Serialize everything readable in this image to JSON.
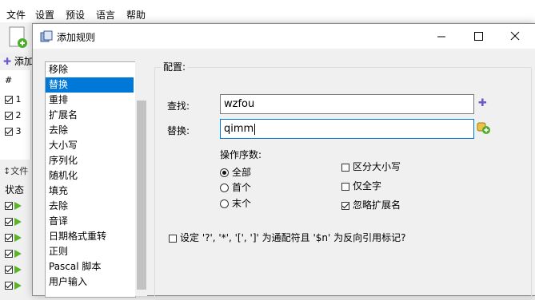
{
  "menubar": [
    "文件",
    "设置",
    "预设",
    "语言",
    "帮助"
  ],
  "background": {
    "add_label": "添加",
    "list_header": "#",
    "rows": [
      "1",
      "2",
      "3"
    ],
    "files_label": "文件",
    "status_label": "状态"
  },
  "dialog": {
    "title": "添加规则",
    "rules": [
      "移除",
      "替换",
      "重排",
      "扩展名",
      "去除",
      "大小写",
      "序列化",
      "随机化",
      "填充",
      "去除",
      "音译",
      "日期格式重转",
      "正则",
      "Pascal 脚本",
      "用户输入"
    ],
    "selected_index": 1,
    "config_title": "配置:",
    "find_label": "查找:",
    "find_value": "wzfou",
    "replace_label": "替换:",
    "replace_value": "qimm",
    "occurrences_label": "操作序数:",
    "options": {
      "all": "全部",
      "first": "首个",
      "last": "末个",
      "case_sensitive": "区分大小写",
      "whole_words": "仅全字",
      "skip_extension": "忽略扩展名"
    },
    "wildcard_label": "设定 '?', '*', '[', ']' 为通配符且 '$n' 为反向引用标记?",
    "checked": {
      "all": true,
      "case_sensitive": false,
      "whole_words": false,
      "skip_extension": true,
      "wildcards": false
    }
  },
  "colors": {
    "accent": "#0078d7",
    "plus_icon": "#6a5acd",
    "arrow": "#5ab42a"
  }
}
